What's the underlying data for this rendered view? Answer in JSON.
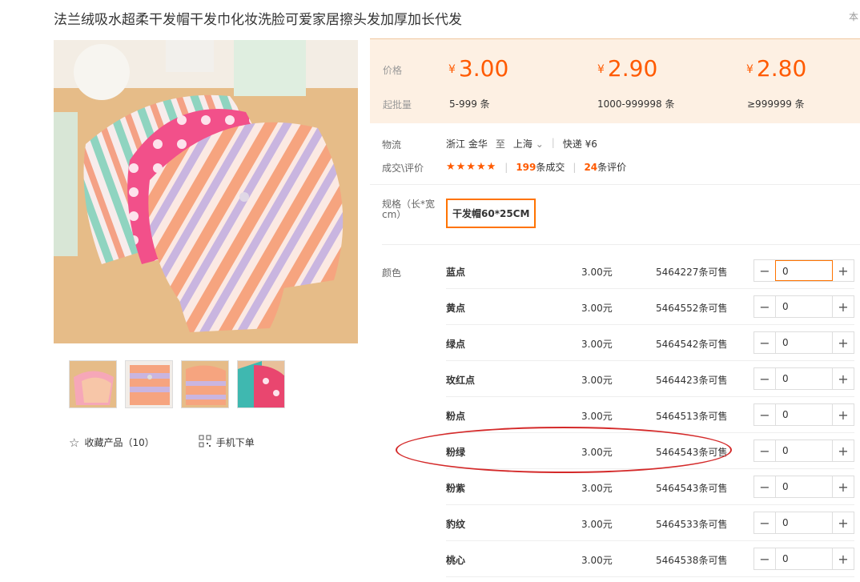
{
  "product": {
    "title": "法兰绒吸水超柔干发帽干发巾化妆洗脸可爱家居擦头发加厚加长代发",
    "corner_text": "本"
  },
  "gallery": {
    "thumbnails": [
      "thumb-1",
      "thumb-2",
      "thumb-3",
      "thumb-4"
    ]
  },
  "actions": {
    "favorite_label": "收藏产品（10）",
    "mobile_order_label": "手机下单"
  },
  "pricing": {
    "price_label": "价格",
    "moq_label": "起批量",
    "currency": "¥",
    "tiers": [
      {
        "price": "3.00",
        "range": "5-999 条"
      },
      {
        "price": "2.90",
        "range": "1000-999998 条"
      },
      {
        "price": "2.80",
        "range": "≥999999 条"
      }
    ]
  },
  "logistics": {
    "label": "物流",
    "from": "浙江 金华",
    "to_word": "至",
    "to": "上海",
    "shipping": "快递 ¥6"
  },
  "deals": {
    "label": "成交\\评价",
    "rating_stars": 5,
    "orders_count": "199",
    "orders_suffix": "条成交",
    "reviews_count": "24",
    "reviews_suffix": "条评价"
  },
  "spec": {
    "label": "规格（长*宽cm）",
    "selected": "干发帽60*25CM"
  },
  "colors": {
    "label": "颜色",
    "items": [
      {
        "name": "蓝点",
        "price": "3.00元",
        "stock": "5464227条可售",
        "qty": "0"
      },
      {
        "name": "黄点",
        "price": "3.00元",
        "stock": "5464552条可售",
        "qty": "0"
      },
      {
        "name": "绿点",
        "price": "3.00元",
        "stock": "5464542条可售",
        "qty": "0"
      },
      {
        "name": "玫红点",
        "price": "3.00元",
        "stock": "5464423条可售",
        "qty": "0"
      },
      {
        "name": "粉点",
        "price": "3.00元",
        "stock": "5464513条可售",
        "qty": "0"
      },
      {
        "name": "粉绿",
        "price": "3.00元",
        "stock": "5464543条可售",
        "qty": "0"
      },
      {
        "name": "粉紫",
        "price": "3.00元",
        "stock": "5464543条可售",
        "qty": "0"
      },
      {
        "name": "豹纹",
        "price": "3.00元",
        "stock": "5464533条可售",
        "qty": "0"
      },
      {
        "name": "桃心",
        "price": "3.00元",
        "stock": "5464538条可售",
        "qty": "0"
      }
    ]
  },
  "colors_theme": {
    "accent": "#ff5a00",
    "price_panel_bg": "#fdf0e3",
    "annotation_red": "#d42a2a"
  }
}
